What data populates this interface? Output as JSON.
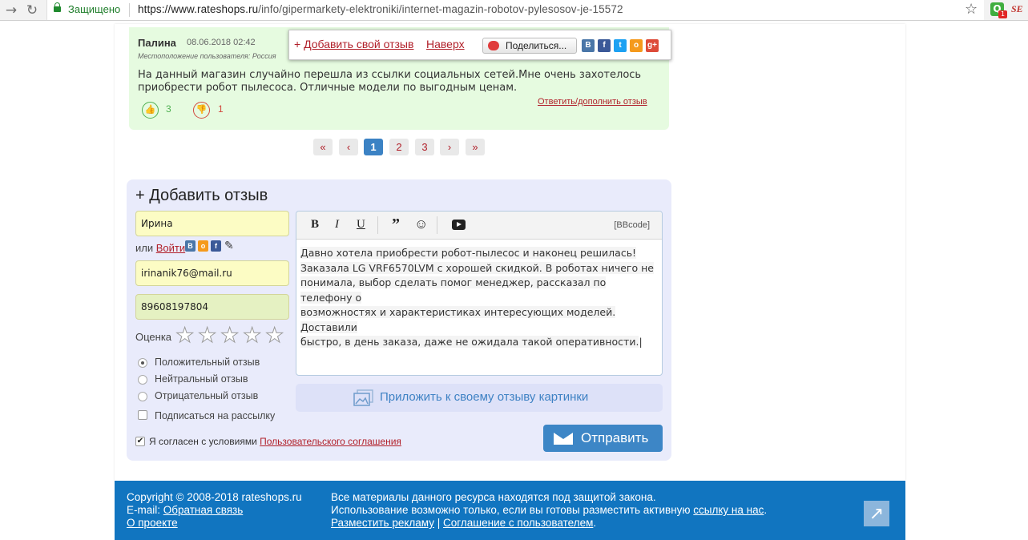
{
  "browser": {
    "secure_label": "Защищено",
    "url_base": "https://www.rateshops.ru",
    "url_path": "/info/gipermarkety-elektroniki/internet-magazin-robotov-pylesosov-je-15572",
    "ext_badge": "1",
    "ext2_label": "SE"
  },
  "review": {
    "author": "Палина",
    "date": "08.06.2018 02:42",
    "location": "Местоположение пользователя: Россия",
    "text": "На данный магазин случайно перешла из ссылки социальных сетей.Мне очень захотелось приобрести робот пылесоса. Отличные модели по выгодным ценам.",
    "likes": "3",
    "dislikes": "1",
    "reply": "Ответить/дополнить отзыв"
  },
  "popbar": {
    "add": "Добавить свой отзыв",
    "top": "Наверх",
    "share": "Поделиться...",
    "social": [
      "В",
      "f",
      "t",
      "o",
      "g+"
    ]
  },
  "pagination": [
    "«",
    "‹",
    "1",
    "2",
    "3",
    "›",
    "»"
  ],
  "form": {
    "title": "+ Добавить отзыв",
    "name": "Ирина",
    "or": "или",
    "login": "Войти",
    "email": "irinanik76@mail.ru",
    "phone": "89608197804",
    "rating_label": "Оценка",
    "rating_value": 0,
    "rating_max": 5,
    "options": [
      "Положительный отзыв",
      "Нейтральный отзыв",
      "Отрицательный отзыв"
    ],
    "selected_option": 0,
    "subscribe": "Подписаться на рассылку",
    "agree_text": "Я согласен с условиями",
    "agree_link": "Пользовательского соглашения",
    "editor_mode": "[BBcode]",
    "editor_lines": [
      "Давно хотела приобрести робот-пылесос и наконец решилась!",
      "Заказала LG VRF6570LVM с хорошей скидкой. В роботах ничего не",
      "понимала, выбор сделать помог менеджер, рассказал по телефону о",
      "возможностях и характеристиках интересующих моделей. Доставили",
      "быстро, в день заказа, даже не ожидала такой оперативности."
    ],
    "attach": "Приложить к своему отзыву картинки",
    "send": "Отправить"
  },
  "footer": {
    "copyright": "Copyright © 2008-2018 rateshops.ru",
    "email_label": "E-mail:",
    "feedback": "Обратная связь",
    "about": "О проекте",
    "protected": "Все материалы данного ресурса находятся под защитой закона.",
    "usage": "Использование возможно только, если вы готовы разместить активную",
    "link_to_us": "ссылку на нас",
    "ads": "Разместить рекламу",
    "sep": "|",
    "agreement": "Соглашение с пользователем"
  },
  "colors": {
    "accent": "#b1202a",
    "blue": "#3d86c6",
    "footer": "#1175c0"
  }
}
